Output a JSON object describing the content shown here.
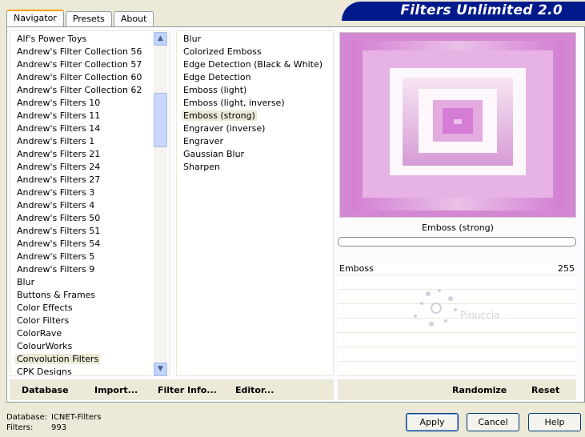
{
  "tabs": [
    "Navigator",
    "Presets",
    "About"
  ],
  "banner": {
    "title": "Filters Unlimited 2.0"
  },
  "categories": [
    "Alf's Power Toys",
    "Andrew's Filter Collection 56",
    "Andrew's Filter Collection 57",
    "Andrew's Filter Collection 60",
    "Andrew's Filter Collection 62",
    "Andrew's Filters 10",
    "Andrew's Filters 11",
    "Andrew's Filters 14",
    "Andrew's Filters 1",
    "Andrew's Filters 21",
    "Andrew's Filters 24",
    "Andrew's Filters 27",
    "Andrew's Filters 3",
    "Andrew's Filters 4",
    "Andrew's Filters 50",
    "Andrew's Filters 51",
    "Andrew's Filters 54",
    "Andrew's Filters 5",
    "Andrew's Filters 9",
    "Blur",
    "Buttons & Frames",
    "Color Effects",
    "Color Filters",
    "ColorRave",
    "ColourWorks",
    "Convolution Filters",
    "CPK Designs"
  ],
  "selected_category": "Convolution Filters",
  "filters": [
    "Blur",
    "Colorized Emboss",
    "Edge Detection (Black & White)",
    "Edge Detection",
    "Emboss (light)",
    "Emboss (light, inverse)",
    "Emboss (strong)",
    "Engraver (inverse)",
    "Engraver",
    "Gaussian Blur",
    "Sharpen"
  ],
  "selected_filter": "Emboss (strong)",
  "preview": {
    "caption": "Emboss (strong)"
  },
  "params": [
    {
      "name": "Emboss",
      "value": "255"
    }
  ],
  "watermark": "Pinuccia",
  "left_buttons": {
    "database": "Database",
    "import": "Import...",
    "filter_info": "Filter Info...",
    "editor": "Editor..."
  },
  "right_buttons": {
    "randomize": "Randomize",
    "reset": "Reset"
  },
  "status": {
    "database_label": "Database:",
    "database_value": "ICNET-Filters",
    "filters_label": "Filters:",
    "filters_value": "993"
  },
  "dialog_buttons": {
    "apply": "Apply",
    "cancel": "Cancel",
    "help": "Help"
  },
  "scrollbar": {
    "up": "▲",
    "down": "▼"
  }
}
